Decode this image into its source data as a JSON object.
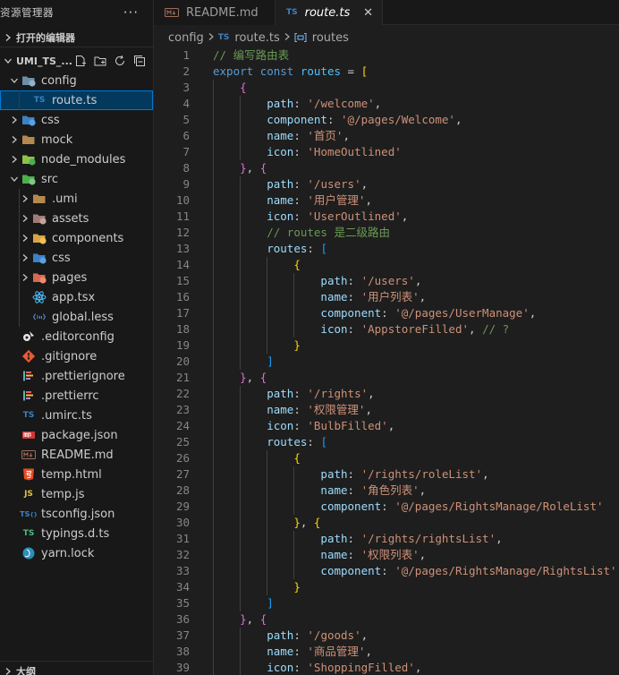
{
  "explorer": {
    "title": "资源管理器",
    "more": "···",
    "open_editors": "打开的编辑器",
    "project": "UMI_TS_...",
    "outline": "大纲",
    "tree": [
      {
        "label": "config",
        "depth": 0,
        "twisty": "open",
        "icon": "folder-config"
      },
      {
        "label": "route.ts",
        "depth": 1,
        "twisty": "none",
        "icon": "ts-file",
        "selected": true
      },
      {
        "label": "css",
        "depth": 0,
        "twisty": "closed",
        "icon": "folder-css"
      },
      {
        "label": "mock",
        "depth": 0,
        "twisty": "closed",
        "icon": "folder"
      },
      {
        "label": "node_modules",
        "depth": 0,
        "twisty": "closed",
        "icon": "folder-node"
      },
      {
        "label": "src",
        "depth": 0,
        "twisty": "open",
        "icon": "folder-src"
      },
      {
        "label": ".umi",
        "depth": 1,
        "twisty": "closed",
        "icon": "folder"
      },
      {
        "label": "assets",
        "depth": 1,
        "twisty": "closed",
        "icon": "folder-assets"
      },
      {
        "label": "components",
        "depth": 1,
        "twisty": "closed",
        "icon": "folder-components"
      },
      {
        "label": "css",
        "depth": 1,
        "twisty": "closed",
        "icon": "folder-css"
      },
      {
        "label": "pages",
        "depth": 1,
        "twisty": "closed",
        "icon": "folder-pages"
      },
      {
        "label": "app.tsx",
        "depth": 1,
        "twisty": "none",
        "icon": "react-file"
      },
      {
        "label": "global.less",
        "depth": 1,
        "twisty": "none",
        "icon": "less-file"
      },
      {
        "label": ".editorconfig",
        "depth": 0,
        "twisty": "none",
        "icon": "editorconfig-file"
      },
      {
        "label": ".gitignore",
        "depth": 0,
        "twisty": "none",
        "icon": "git-file"
      },
      {
        "label": ".prettierignore",
        "depth": 0,
        "twisty": "none",
        "icon": "prettier-file"
      },
      {
        "label": ".prettierrc",
        "depth": 0,
        "twisty": "none",
        "icon": "prettier-file"
      },
      {
        "label": ".umirc.ts",
        "depth": 0,
        "twisty": "none",
        "icon": "ts-file"
      },
      {
        "label": "package.json",
        "depth": 0,
        "twisty": "none",
        "icon": "npm-file"
      },
      {
        "label": "README.md",
        "depth": 0,
        "twisty": "none",
        "icon": "md-file"
      },
      {
        "label": "temp.html",
        "depth": 0,
        "twisty": "none",
        "icon": "html-file"
      },
      {
        "label": "temp.js",
        "depth": 0,
        "twisty": "none",
        "icon": "js-file"
      },
      {
        "label": "tsconfig.json",
        "depth": 0,
        "twisty": "none",
        "icon": "tsconfig-file"
      },
      {
        "label": "typings.d.ts",
        "depth": 0,
        "twisty": "none",
        "icon": "dts-file"
      },
      {
        "label": "yarn.lock",
        "depth": 0,
        "twisty": "none",
        "icon": "yarn-file"
      }
    ]
  },
  "tabs": [
    {
      "label": "README.md",
      "icon": "md-file",
      "active": false
    },
    {
      "label": "route.ts",
      "icon": "ts-file",
      "active": true,
      "close": "✕"
    }
  ],
  "breadcrumb": {
    "folder": "config",
    "file": "route.ts",
    "symbol": "routes"
  },
  "colors": {
    "accent": "#0078d4",
    "selection": "#04395e",
    "comment": "#6a9955",
    "keyword": "#569cd6",
    "string": "#ce9178",
    "property": "#9cdcfe"
  },
  "code": [
    {
      "n": "1",
      "indent": 0,
      "t": [
        [
          "// 编写路由表",
          "com"
        ]
      ]
    },
    {
      "n": "2",
      "indent": 0,
      "t": [
        [
          "export",
          "kw"
        ],
        [
          " ",
          "pun"
        ],
        [
          "const",
          "kw"
        ],
        [
          " ",
          "pun"
        ],
        [
          "routes",
          "var"
        ],
        [
          " = ",
          "pun"
        ],
        [
          "[",
          "b1"
        ]
      ]
    },
    {
      "n": "3",
      "indent": 1,
      "t": [
        [
          "{",
          "b2"
        ]
      ]
    },
    {
      "n": "4",
      "indent": 2,
      "t": [
        [
          "path",
          "prop"
        ],
        [
          ": ",
          "pun"
        ],
        [
          "'/welcome'",
          "str"
        ],
        [
          ",",
          "pun"
        ]
      ]
    },
    {
      "n": "5",
      "indent": 2,
      "t": [
        [
          "component",
          "prop"
        ],
        [
          ": ",
          "pun"
        ],
        [
          "'@/pages/Welcome'",
          "str"
        ],
        [
          ",",
          "pun"
        ]
      ]
    },
    {
      "n": "6",
      "indent": 2,
      "t": [
        [
          "name",
          "prop"
        ],
        [
          ": ",
          "pun"
        ],
        [
          "'首页'",
          "str"
        ],
        [
          ",",
          "pun"
        ]
      ]
    },
    {
      "n": "7",
      "indent": 2,
      "t": [
        [
          "icon",
          "prop"
        ],
        [
          ": ",
          "pun"
        ],
        [
          "'HomeOutlined'",
          "str"
        ]
      ]
    },
    {
      "n": "8",
      "indent": 1,
      "t": [
        [
          "}",
          "b2"
        ],
        [
          ", ",
          "pun"
        ],
        [
          "{",
          "b2"
        ]
      ]
    },
    {
      "n": "9",
      "indent": 2,
      "t": [
        [
          "path",
          "prop"
        ],
        [
          ": ",
          "pun"
        ],
        [
          "'/users'",
          "str"
        ],
        [
          ",",
          "pun"
        ]
      ]
    },
    {
      "n": "10",
      "indent": 2,
      "t": [
        [
          "name",
          "prop"
        ],
        [
          ": ",
          "pun"
        ],
        [
          "'用户管理'",
          "str"
        ],
        [
          ",",
          "pun"
        ]
      ]
    },
    {
      "n": "11",
      "indent": 2,
      "t": [
        [
          "icon",
          "prop"
        ],
        [
          ": ",
          "pun"
        ],
        [
          "'UserOutlined'",
          "str"
        ],
        [
          ",",
          "pun"
        ]
      ]
    },
    {
      "n": "12",
      "indent": 2,
      "t": [
        [
          "// routes 是二级路由",
          "com"
        ]
      ]
    },
    {
      "n": "13",
      "indent": 2,
      "t": [
        [
          "routes",
          "prop"
        ],
        [
          ": ",
          "pun"
        ],
        [
          "[",
          "b3"
        ]
      ]
    },
    {
      "n": "14",
      "indent": 3,
      "t": [
        [
          "{",
          "b1"
        ]
      ]
    },
    {
      "n": "15",
      "indent": 4,
      "t": [
        [
          "path",
          "prop"
        ],
        [
          ": ",
          "pun"
        ],
        [
          "'/users'",
          "str"
        ],
        [
          ",",
          "pun"
        ]
      ]
    },
    {
      "n": "16",
      "indent": 4,
      "t": [
        [
          "name",
          "prop"
        ],
        [
          ": ",
          "pun"
        ],
        [
          "'用户列表'",
          "str"
        ],
        [
          ",",
          "pun"
        ]
      ]
    },
    {
      "n": "17",
      "indent": 4,
      "t": [
        [
          "component",
          "prop"
        ],
        [
          ": ",
          "pun"
        ],
        [
          "'@/pages/UserManage'",
          "str"
        ],
        [
          ",",
          "pun"
        ]
      ]
    },
    {
      "n": "18",
      "indent": 4,
      "t": [
        [
          "icon",
          "prop"
        ],
        [
          ": ",
          "pun"
        ],
        [
          "'AppstoreFilled'",
          "str"
        ],
        [
          ", ",
          "pun"
        ],
        [
          "// ?",
          "com"
        ]
      ]
    },
    {
      "n": "19",
      "indent": 3,
      "t": [
        [
          "}",
          "b1"
        ]
      ]
    },
    {
      "n": "20",
      "indent": 2,
      "t": [
        [
          "]",
          "b3"
        ]
      ]
    },
    {
      "n": "21",
      "indent": 1,
      "t": [
        [
          "}",
          "b2"
        ],
        [
          ", ",
          "pun"
        ],
        [
          "{",
          "b2"
        ]
      ]
    },
    {
      "n": "22",
      "indent": 2,
      "t": [
        [
          "path",
          "prop"
        ],
        [
          ": ",
          "pun"
        ],
        [
          "'/rights'",
          "str"
        ],
        [
          ",",
          "pun"
        ]
      ]
    },
    {
      "n": "23",
      "indent": 2,
      "t": [
        [
          "name",
          "prop"
        ],
        [
          ": ",
          "pun"
        ],
        [
          "'权限管理'",
          "str"
        ],
        [
          ",",
          "pun"
        ]
      ]
    },
    {
      "n": "24",
      "indent": 2,
      "t": [
        [
          "icon",
          "prop"
        ],
        [
          ": ",
          "pun"
        ],
        [
          "'BulbFilled'",
          "str"
        ],
        [
          ",",
          "pun"
        ]
      ]
    },
    {
      "n": "25",
      "indent": 2,
      "t": [
        [
          "routes",
          "prop"
        ],
        [
          ": ",
          "pun"
        ],
        [
          "[",
          "b3"
        ]
      ]
    },
    {
      "n": "26",
      "indent": 3,
      "t": [
        [
          "{",
          "b1"
        ]
      ]
    },
    {
      "n": "27",
      "indent": 4,
      "t": [
        [
          "path",
          "prop"
        ],
        [
          ": ",
          "pun"
        ],
        [
          "'/rights/roleList'",
          "str"
        ],
        [
          ",",
          "pun"
        ]
      ]
    },
    {
      "n": "28",
      "indent": 4,
      "t": [
        [
          "name",
          "prop"
        ],
        [
          ": ",
          "pun"
        ],
        [
          "'角色列表'",
          "str"
        ],
        [
          ",",
          "pun"
        ]
      ]
    },
    {
      "n": "29",
      "indent": 4,
      "t": [
        [
          "component",
          "prop"
        ],
        [
          ": ",
          "pun"
        ],
        [
          "'@/pages/RightsManage/RoleList'",
          "str"
        ]
      ]
    },
    {
      "n": "30",
      "indent": 3,
      "t": [
        [
          "}",
          "b1"
        ],
        [
          ", ",
          "pun"
        ],
        [
          "{",
          "b1"
        ]
      ]
    },
    {
      "n": "31",
      "indent": 4,
      "t": [
        [
          "path",
          "prop"
        ],
        [
          ": ",
          "pun"
        ],
        [
          "'/rights/rightsList'",
          "str"
        ],
        [
          ",",
          "pun"
        ]
      ]
    },
    {
      "n": "32",
      "indent": 4,
      "t": [
        [
          "name",
          "prop"
        ],
        [
          ": ",
          "pun"
        ],
        [
          "'权限列表'",
          "str"
        ],
        [
          ",",
          "pun"
        ]
      ]
    },
    {
      "n": "33",
      "indent": 4,
      "t": [
        [
          "component",
          "prop"
        ],
        [
          ": ",
          "pun"
        ],
        [
          "'@/pages/RightsManage/RightsList'",
          "str"
        ]
      ]
    },
    {
      "n": "34",
      "indent": 3,
      "t": [
        [
          "}",
          "b1"
        ]
      ]
    },
    {
      "n": "35",
      "indent": 2,
      "t": [
        [
          "]",
          "b3"
        ]
      ]
    },
    {
      "n": "36",
      "indent": 1,
      "t": [
        [
          "}",
          "b2"
        ],
        [
          ", ",
          "pun"
        ],
        [
          "{",
          "b2"
        ]
      ]
    },
    {
      "n": "37",
      "indent": 2,
      "t": [
        [
          "path",
          "prop"
        ],
        [
          ": ",
          "pun"
        ],
        [
          "'/goods'",
          "str"
        ],
        [
          ",",
          "pun"
        ]
      ]
    },
    {
      "n": "38",
      "indent": 2,
      "t": [
        [
          "name",
          "prop"
        ],
        [
          ": ",
          "pun"
        ],
        [
          "'商品管理'",
          "str"
        ],
        [
          ",",
          "pun"
        ]
      ]
    },
    {
      "n": "39",
      "indent": 2,
      "t": [
        [
          "icon",
          "prop"
        ],
        [
          ": ",
          "pun"
        ],
        [
          "'ShoppingFilled'",
          "str"
        ],
        [
          ",",
          "pun"
        ]
      ]
    }
  ]
}
